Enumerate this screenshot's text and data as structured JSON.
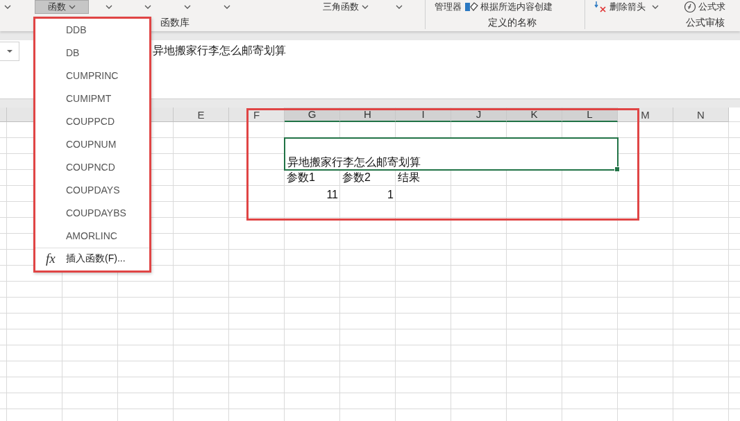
{
  "ribbon": {
    "groups": [
      {
        "label": "函数库",
        "items": [
          {
            "kind": "caret"
          },
          {
            "kind": "dropdown",
            "label": "函数",
            "selected": true
          },
          {
            "kind": "caret"
          },
          {
            "kind": "caret"
          },
          {
            "kind": "caret"
          },
          {
            "kind": "caret"
          },
          {
            "kind": "dropdown",
            "label": "三角函数",
            "selected": false
          },
          {
            "kind": "caret"
          }
        ]
      },
      {
        "label": "定义的名称",
        "items": [
          {
            "kind": "command",
            "label": "管理器"
          },
          {
            "kind": "tag-command",
            "label": "根据所选内容创建"
          }
        ]
      },
      {
        "label": "公式审核",
        "items": [
          {
            "kind": "arrow-command",
            "label": "删除箭头"
          },
          {
            "kind": "caret"
          },
          {
            "kind": "circle-command",
            "label": "公式求"
          }
        ]
      }
    ]
  },
  "formula_bar": {
    "value": "异地搬家行李怎么邮寄划算"
  },
  "sheet": {
    "columns": [
      {
        "label": "E",
        "selected": false
      },
      {
        "label": "F",
        "selected": false
      },
      {
        "label": "G",
        "selected": true
      },
      {
        "label": "H",
        "selected": true
      },
      {
        "label": "I",
        "selected": true
      },
      {
        "label": "J",
        "selected": true
      },
      {
        "label": "K",
        "selected": true
      },
      {
        "label": "L",
        "selected": true
      },
      {
        "label": "M",
        "selected": false
      },
      {
        "label": "N",
        "selected": false
      }
    ],
    "title_cell": "异地搬家行李怎么邮寄划算",
    "rows": [
      [
        {
          "text": ""
        },
        {
          "text": ""
        },
        {
          "text": "参数1",
          "kind": "text"
        },
        {
          "text": "参数2",
          "kind": "text"
        },
        {
          "text": "结果",
          "kind": "text"
        }
      ],
      [
        {
          "text": ""
        },
        {
          "text": ""
        },
        {
          "text": "11",
          "kind": "number"
        },
        {
          "text": "1",
          "kind": "number"
        }
      ]
    ]
  },
  "menu": {
    "items": [
      {
        "label": "DDB",
        "kind": "function"
      },
      {
        "label": "DB",
        "kind": "function"
      },
      {
        "label": "CUMPRINC",
        "kind": "function"
      },
      {
        "label": "CUMIPMT",
        "kind": "function"
      },
      {
        "label": "COUPPCD",
        "kind": "function"
      },
      {
        "label": "COUPNUM",
        "kind": "function"
      },
      {
        "label": "COUPNCD",
        "kind": "function"
      },
      {
        "label": "COUPDAYS",
        "kind": "function"
      },
      {
        "label": "COUPDAYBS",
        "kind": "function"
      },
      {
        "label": "AMORLINC",
        "kind": "function"
      },
      {
        "label": "插入函数(F)...",
        "kind": "insert",
        "icon": "fx"
      }
    ]
  }
}
